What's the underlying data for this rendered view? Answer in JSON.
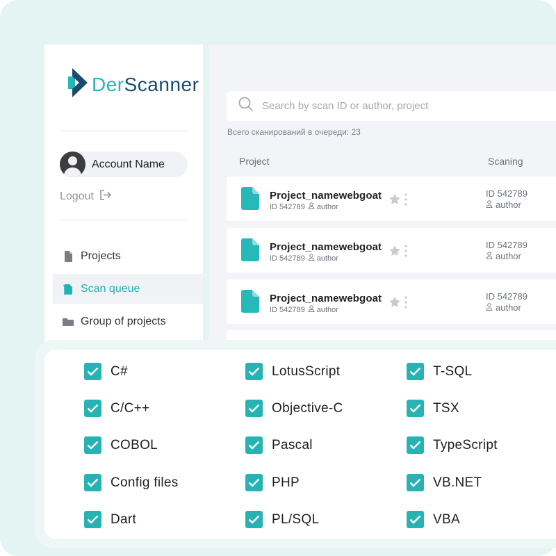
{
  "brand": {
    "logo_text_a": "Der",
    "logo_text_b": "Scanner",
    "colors": {
      "navy": "#1a4b6e",
      "teal": "#25b7b7"
    }
  },
  "sidebar": {
    "account_name": "Account Name",
    "logout_label": "Logout",
    "nav": [
      {
        "label": "Projects",
        "icon": "file-icon",
        "active": false
      },
      {
        "label": "Scan queue",
        "icon": "scan-queue-icon",
        "active": true
      },
      {
        "label": "Group of projects",
        "icon": "folder-icon",
        "active": false
      }
    ]
  },
  "main": {
    "search_placeholder": "Search by scan ID or author, project",
    "queue_count_text": "Всего сканирований в очереди: 23",
    "columns": {
      "project": "Project",
      "scanning": "Scaning"
    },
    "rows": [
      {
        "project_name": "Project_namewebgoat",
        "id_text": "ID 542789",
        "author": "author",
        "scan_id": "ID 542789",
        "scan_author": "author"
      },
      {
        "project_name": "Project_namewebgoat",
        "id_text": "ID 542789",
        "author": "author",
        "scan_id": "ID 542789",
        "scan_author": "author"
      },
      {
        "project_name": "Project_namewebgoat",
        "id_text": "ID 542789",
        "author": "author",
        "scan_id": "ID 542789",
        "scan_author": "author"
      }
    ]
  },
  "languages": {
    "col1": [
      {
        "label": "C#",
        "checked": true
      },
      {
        "label": "C/C++",
        "checked": true
      },
      {
        "label": "COBOL",
        "checked": true
      },
      {
        "label": "Config files",
        "checked": true
      },
      {
        "label": "Dart",
        "checked": true
      }
    ],
    "col2": [
      {
        "label": "LotusScript",
        "checked": true
      },
      {
        "label": "Objective-C",
        "checked": true
      },
      {
        "label": "Pascal",
        "checked": true
      },
      {
        "label": "PHP",
        "checked": true
      },
      {
        "label": "PL/SQL",
        "checked": true
      }
    ],
    "col3": [
      {
        "label": "T-SQL",
        "checked": true
      },
      {
        "label": "TSX",
        "checked": true
      },
      {
        "label": "TypeScript",
        "checked": true
      },
      {
        "label": "VB.NET",
        "checked": true
      },
      {
        "label": "VBA",
        "checked": true
      }
    ]
  },
  "colors": {
    "accent": "#27b3b3",
    "background": "#e4f4f2",
    "panel": "#f2f4f7"
  }
}
